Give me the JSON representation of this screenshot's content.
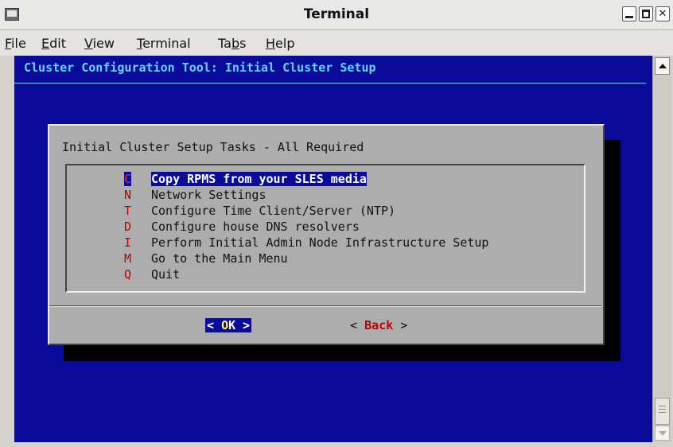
{
  "window": {
    "title": "Terminal"
  },
  "menubar": [
    {
      "pre": "",
      "u": "F",
      "post": "ile"
    },
    {
      "pre": "",
      "u": "E",
      "post": "dit"
    },
    {
      "pre": "",
      "u": "V",
      "post": "iew"
    },
    {
      "pre": "",
      "u": "T",
      "post": "erminal"
    },
    {
      "pre": "Ta",
      "u": "b",
      "post": "s"
    },
    {
      "pre": "",
      "u": "H",
      "post": "elp"
    }
  ],
  "terminal": {
    "header": "Cluster Configuration Tool: Initial Cluster Setup",
    "dialog": {
      "title": "Initial Cluster Setup Tasks - All Required",
      "items": [
        {
          "key": "C",
          "label": "Copy RPMS from your SLES media"
        },
        {
          "key": "N",
          "label": "Network Settings"
        },
        {
          "key": "T",
          "label": "Configure Time Client/Server (NTP)"
        },
        {
          "key": "D",
          "label": "Configure house DNS resolvers"
        },
        {
          "key": "I",
          "label": "Perform Initial Admin Node Infrastructure Setup"
        },
        {
          "key": "M",
          "label": "Go to the Main Menu"
        },
        {
          "key": "Q",
          "label": "Quit"
        }
      ],
      "ok_button": {
        "left": "< ",
        "hot": "O",
        "rest": "K >"
      },
      "back_button": {
        "left": "< ",
        "hot": "Back",
        "rest": " >"
      }
    }
  },
  "colors": {
    "terminal_bg": "#0a0a9b",
    "header_fg": "#5fd7ff",
    "dialog_bg": "#adadad",
    "hotkey": "#c00000"
  },
  "icons": [
    "terminal-app-icon",
    "minimize-icon",
    "maximize-icon",
    "close-icon",
    "scroll-up-arrow-icon",
    "scroll-down-arrow-icon"
  ]
}
